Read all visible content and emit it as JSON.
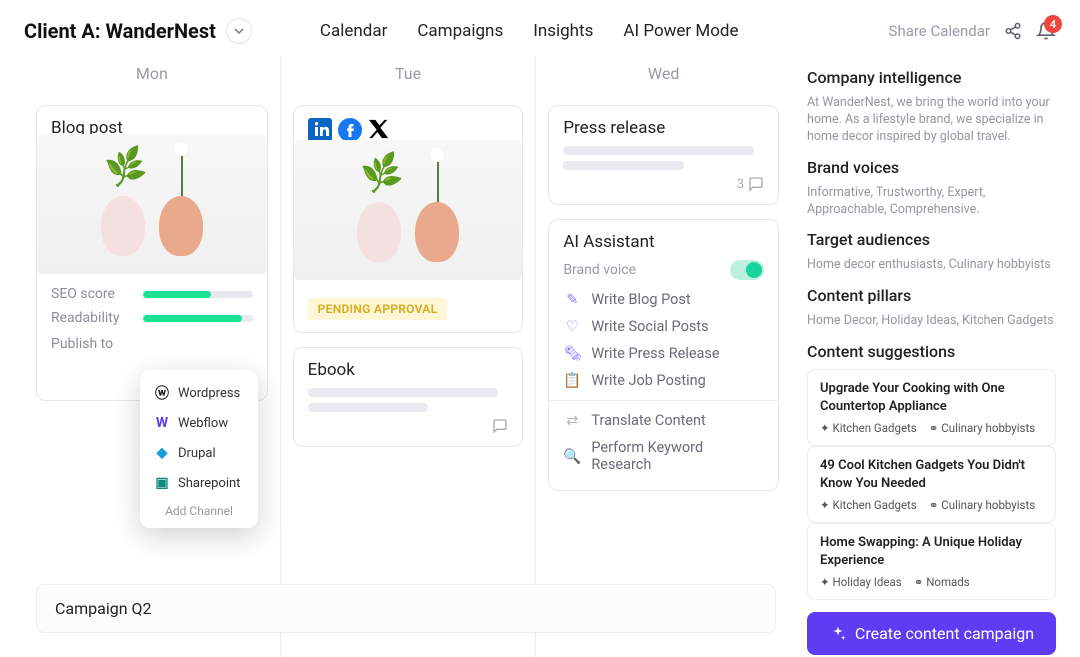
{
  "header": {
    "title": "Client A: WanderNest",
    "nav": [
      "Calendar",
      "Campaigns",
      "Insights",
      "AI Power Mode"
    ],
    "share": "Share Calendar",
    "badge": "4"
  },
  "days": [
    "Mon",
    "Tue",
    "Wed"
  ],
  "mon": {
    "card_title": "Blog post",
    "metrics": {
      "seo": "SEO score",
      "read": "Readability",
      "seo_pct": 62,
      "read_pct": 90
    },
    "publish_to": "Publish to"
  },
  "publish_pop": {
    "items": [
      {
        "icon": "wordpress",
        "label": "Wordpress",
        "color": "#222"
      },
      {
        "icon": "webflow",
        "label": "Webflow",
        "color": "#5d3cf3"
      },
      {
        "icon": "drupal",
        "label": "Drupal",
        "color": "#1a9ed9"
      },
      {
        "icon": "sharepoint",
        "label": "Sharepoint",
        "color": "#0f8b7e"
      }
    ],
    "add": "Add Channel"
  },
  "tue": {
    "pending": "PENDING APPROVAL",
    "ebook": "Ebook"
  },
  "wed": {
    "press": "Press release",
    "comments": "3",
    "ai_title": "AI Assistant",
    "brand_voice": "Brand voice",
    "actions": [
      {
        "icon": "✎",
        "label": "Write Blog Post",
        "gray": false
      },
      {
        "icon": "♡",
        "label": "Write Social Posts",
        "gray": false
      },
      {
        "icon": "🗞",
        "label": "Write Press Release",
        "gray": false
      },
      {
        "icon": "📋",
        "label": "Write Job Posting",
        "gray": false
      },
      {
        "icon": "⇄",
        "label": "Translate Content",
        "gray": true
      },
      {
        "icon": "🔍",
        "label": "Perform Keyword Research",
        "gray": true
      }
    ]
  },
  "panel": {
    "ci_h": "Company intelligence",
    "ci_t": "At WanderNest, we bring the world into your home. As a lifestyle brand, we specialize in home decor inspired by global travel.",
    "bv_h": "Brand voices",
    "bv_t": "Informative, Trustworthy, Expert, Approachable, Comprehensive.",
    "ta_h": "Target audiences",
    "ta_t": "Home decor enthusiasts, Culinary hobbyists",
    "cp_h": "Content pillars",
    "cp_t": "Home Decor, Holiday Ideas, Kitchen Gadgets",
    "cs_h": "Content suggestions",
    "sugg": [
      {
        "t": "Upgrade Your Cooking with One Countertop Appliance",
        "a": "Kitchen Gadgets",
        "b": "Culinary hobbyists"
      },
      {
        "t": "49 Cool Kitchen Gadgets You Didn't Know You Needed",
        "a": "Kitchen Gadgets",
        "b": "Culinary hobbyists"
      },
      {
        "t": "Home Swapping: A Unique Holiday Experience",
        "a": "Holiday Ideas",
        "b": "Nomads"
      }
    ],
    "create": "Create content campaign"
  },
  "campaign": "Campaign Q2"
}
